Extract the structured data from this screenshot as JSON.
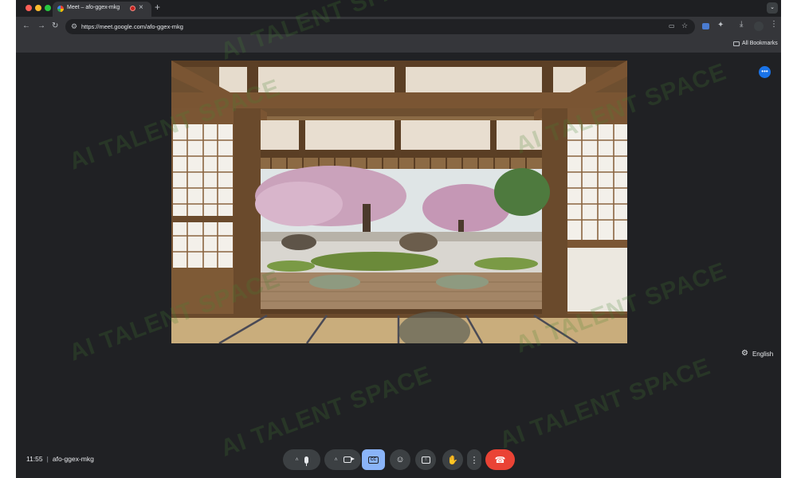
{
  "browser": {
    "tab": {
      "title": "Meet – afo-ggex-mkg",
      "favicon": "chrome-favicon-icon",
      "close_glyph": "×"
    },
    "new_tab_glyph": "+",
    "address_bar": {
      "url": "https://meet.google.com/afo-ggex-mkg"
    },
    "bookmarks": {
      "all_bookmarks_label": "All Bookmarks"
    }
  },
  "meeting": {
    "code": "afo-ggex-mkg",
    "time": "11:55",
    "separator": "|",
    "caption_language": "English",
    "more_options_glyph": "•••"
  },
  "controls": [
    {
      "name": "microphone",
      "icon": "mic-icon",
      "has_chevron": true
    },
    {
      "name": "camera",
      "icon": "camera-icon",
      "has_chevron": true
    },
    {
      "name": "captions",
      "icon": "captions-icon",
      "active": true,
      "text": "CC"
    },
    {
      "name": "reactions",
      "icon": "emoji-icon"
    },
    {
      "name": "present",
      "icon": "present-screen-icon"
    },
    {
      "name": "raise-hand",
      "icon": "hand-icon"
    },
    {
      "name": "more-options",
      "icon": "more-vert-icon"
    },
    {
      "name": "leave-call",
      "icon": "end-call-icon"
    }
  ],
  "watermark": "AI TALENT SPACE",
  "colors": {
    "meet_background": "#202124",
    "captions_active": "#8ab4f8",
    "end_call": "#ea4335",
    "accent_blue": "#1a73e8"
  }
}
